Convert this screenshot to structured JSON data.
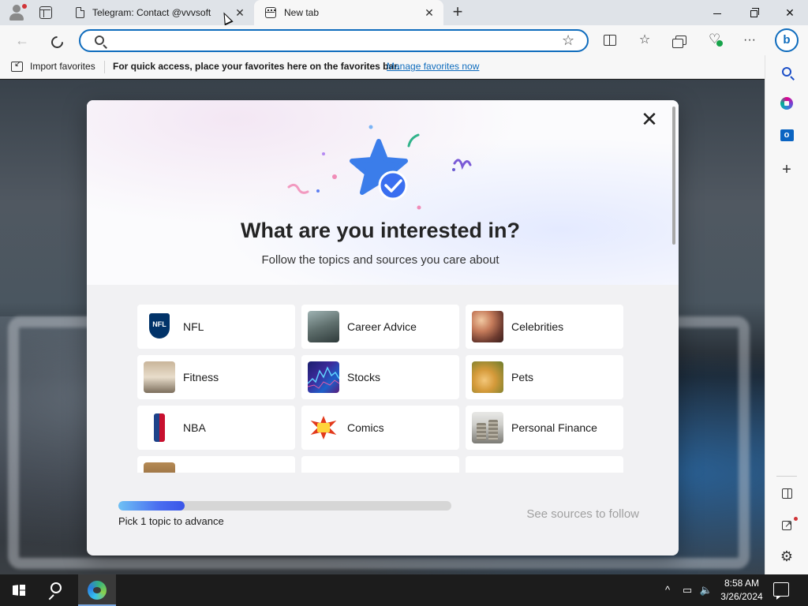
{
  "browser": {
    "tabs": [
      {
        "title": "Telegram: Contact @vvvsoft",
        "active": false
      },
      {
        "title": "New tab",
        "active": true
      }
    ],
    "new_tab_label": "+",
    "close_glyph": "✕"
  },
  "toolbar": {
    "address_value": "",
    "address_placeholder": "",
    "icons": [
      "back-icon",
      "refresh-icon",
      "search-icon",
      "favorite-star-icon",
      "split-screen-icon",
      "favorites-icon",
      "collections-icon",
      "browser-essentials-icon",
      "more-icon",
      "bing-copilot-icon"
    ],
    "more_label": "···",
    "bing_label": "b"
  },
  "favorites_bar": {
    "import_label": "Import favorites",
    "hint": "For quick access, place your favorites here on the favorites bar.",
    "manage_link": "Manage favorites now"
  },
  "modal": {
    "title": "What are you interested in?",
    "subtitle": "Follow the topics and sources you care about",
    "close_glyph": "✕",
    "topics": [
      {
        "label": "NFL"
      },
      {
        "label": "Career Advice"
      },
      {
        "label": "Celebrities"
      },
      {
        "label": "Fitness"
      },
      {
        "label": "Stocks"
      },
      {
        "label": "Pets"
      },
      {
        "label": "NBA"
      },
      {
        "label": "Comics"
      },
      {
        "label": "Personal Finance"
      },
      {
        "label": ""
      },
      {
        "label": ""
      },
      {
        "label": ""
      }
    ],
    "progress_fraction": 0.2,
    "progress_label": "Pick 1 topic to advance",
    "see_sources_label": "See sources to follow"
  },
  "taskbar": {
    "time": "8:58 AM",
    "date": "3/26/2024",
    "tray_up": "^"
  },
  "colors": {
    "accent": "#0f6cbd",
    "progress_start": "#6ec1f5",
    "progress_end": "#3a55e8",
    "star": "#3b7dea"
  }
}
